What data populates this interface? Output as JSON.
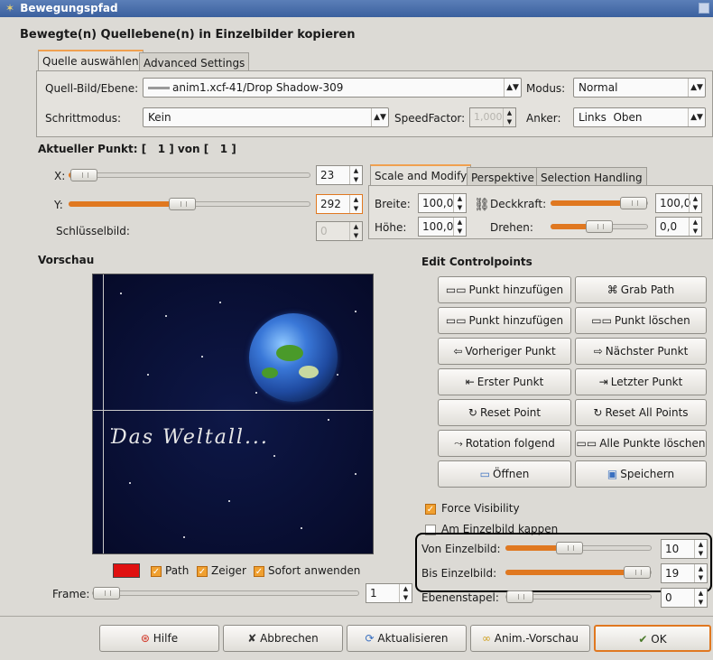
{
  "window": {
    "title": "Bewegungspfad",
    "heading": "Bewegte(n) Quellebene(n) in Einzelbilder kopieren"
  },
  "tabs_top": [
    "Quelle auswählen",
    "Advanced Settings"
  ],
  "source": {
    "label": "Quell-Bild/Ebene:",
    "value": "anim1.xcf-41/Drop Shadow-309",
    "modus_label": "Modus:",
    "modus_value": "Normal",
    "schritt_label": "Schrittmodus:",
    "schritt_value": "Kein",
    "speed_label": "SpeedFactor:",
    "speed_value": "1,000",
    "anker_label": "Anker:",
    "anker_value": "Links  Oben"
  },
  "current_point": {
    "label": "Aktueller Punkt: [   1 ] von [   1 ]",
    "x_label": "X:",
    "x_value": "23",
    "x_level": 0.06,
    "y_label": "Y:",
    "y_value": "292",
    "y_level": 0.47,
    "keyframe_label": "Schlüsselbild:",
    "keyframe_value": "0"
  },
  "tabs_mid": [
    "Scale and Modify",
    "Perspektive",
    "Selection Handling"
  ],
  "scale": {
    "breite_label": "Breite:",
    "breite_value": "100,0",
    "hoehe_label": "Höhe:",
    "hoehe_value": "100,0",
    "deck_label": "Deckkraft:",
    "deck_value": "100,0",
    "deck_level": 1.0,
    "drehen_label": "Drehen:",
    "drehen_value": "0,0",
    "drehen_level": 0.5
  },
  "preview": {
    "label": "Vorschau",
    "text": "Das Weltall...",
    "path_label": "Path",
    "zeiger_label": "Zeiger",
    "sofort_label": "Sofort anwenden",
    "frame_label": "Frame:",
    "frame_value": "1"
  },
  "controlpoints": {
    "label": "Edit Controlpoints",
    "buttons": [
      "Punkt hinzufügen",
      "Grab Path",
      "Punkt hinzufügen",
      "Punkt löschen",
      "Vorheriger Punkt",
      "Nächster Punkt",
      "Erster Punkt",
      "Letzter Punkt",
      "Reset Point",
      "Reset All Points",
      "Rotation folgend",
      "Alle Punkte löschen",
      "Öffnen",
      "Speichern"
    ]
  },
  "options": {
    "force_visibility": "Force Visibility",
    "clip": "Am Einzelbild kappen",
    "von_label": "Von Einzelbild:",
    "von_value": "10",
    "von_level": 0.44,
    "bis_label": "Bis Einzelbild:",
    "bis_value": "19",
    "bis_level": 0.95,
    "stapel_label": "Ebenenstapel:",
    "stapel_value": "0"
  },
  "footer": [
    "Hilfe",
    "Abbrechen",
    "Aktualisieren",
    "Anim.-Vorschau",
    "OK"
  ],
  "colors": {
    "accent": "#e07820",
    "path_color": "#e01010"
  }
}
